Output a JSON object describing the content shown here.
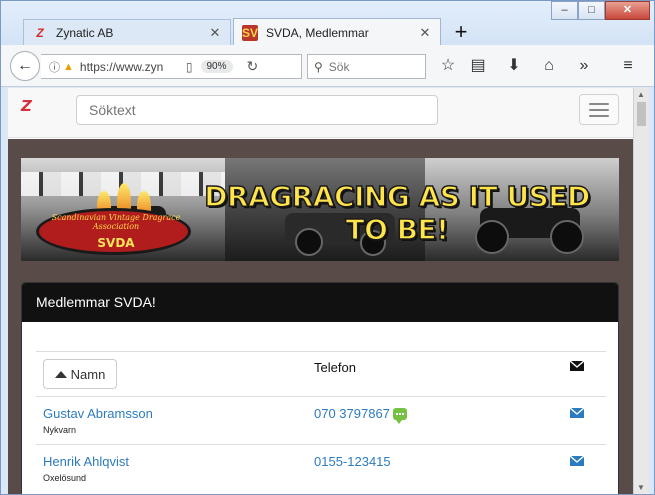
{
  "browser": {
    "tabs": [
      {
        "title": "Zynatic AB",
        "favicon": "Z"
      },
      {
        "title": "SVDA, Medlemmar",
        "favicon": "SV"
      }
    ],
    "new_tab": "+",
    "window_buttons": {
      "minimize": "–",
      "maximize": "□",
      "close": "✕"
    },
    "url": "https://www.zyn",
    "zoom": "90%",
    "search_placeholder": "Sök"
  },
  "site": {
    "logo": "Z",
    "search_placeholder": "Söktext"
  },
  "banner": {
    "slogan": "DRAGRACING AS IT USED TO BE!",
    "badge_text": "Scandinavian Vintage Dragrace Association",
    "badge_short": "SVDA"
  },
  "panel": {
    "title": "Medlemmar SVDA!",
    "sort_button": "Namn",
    "phone_header": "Telefon",
    "members": [
      {
        "name": "Gustav Abramsson",
        "city": "Nykvarn",
        "phone": "070 3797867",
        "sms": true
      },
      {
        "name": "Henrik Ahlqvist",
        "city": "Oxelösund",
        "phone": "0155-123415",
        "sms": false
      }
    ]
  },
  "colors": {
    "link": "#2d7bbf",
    "panel_header": "#111111",
    "page_bg": "#594c48",
    "sms_icon": "#76c043"
  }
}
